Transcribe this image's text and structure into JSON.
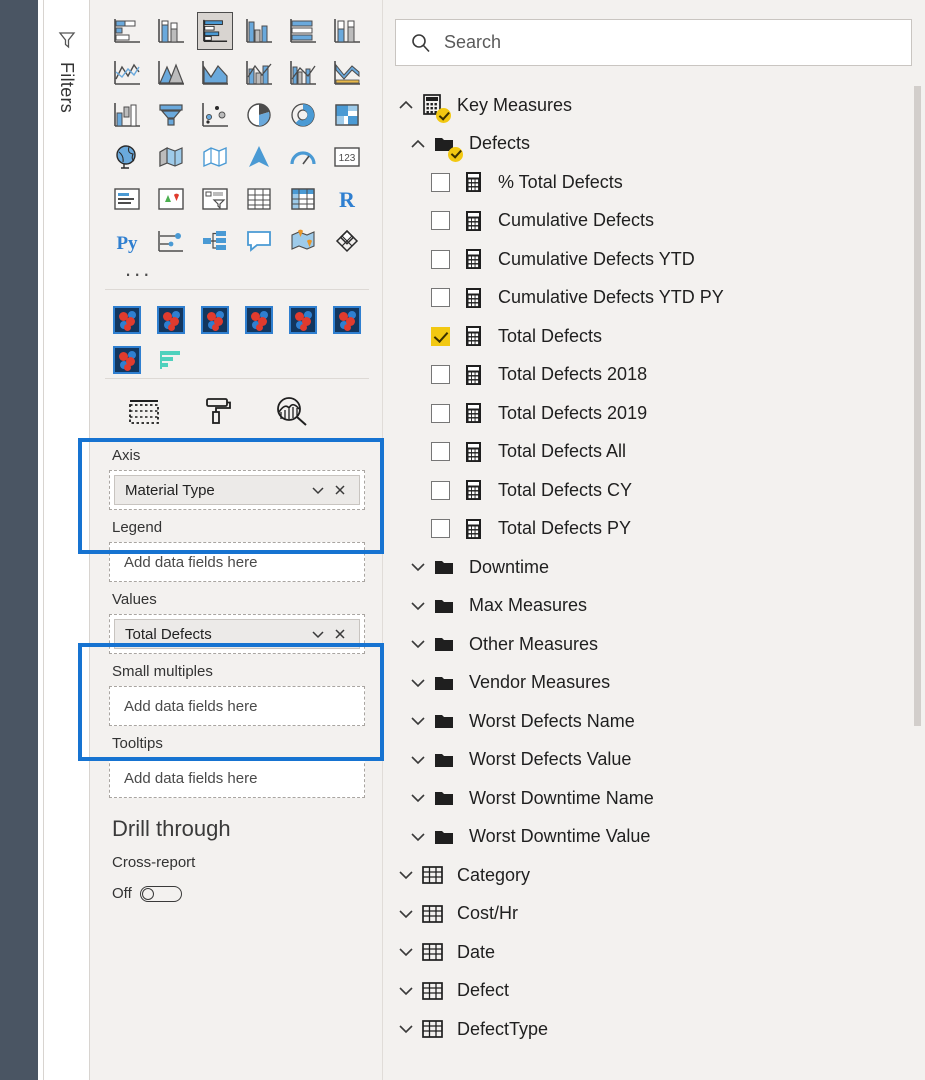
{
  "filters_pane": {
    "label": "Filters",
    "icon": "filter-funnel-icon"
  },
  "visualizations": {
    "gallery": [
      [
        {
          "name": "stacked-bar-chart",
          "selected": false
        },
        {
          "name": "stacked-column-chart",
          "selected": false
        },
        {
          "name": "clustered-bar-chart",
          "selected": true
        },
        {
          "name": "clustered-column-chart",
          "selected": false
        },
        {
          "name": "100-percent-stacked-bar-chart",
          "selected": false
        },
        {
          "name": "100-percent-stacked-column-chart",
          "selected": false
        }
      ],
      [
        {
          "name": "line-chart",
          "selected": false
        },
        {
          "name": "area-chart",
          "selected": false
        },
        {
          "name": "stacked-area-chart",
          "selected": false
        },
        {
          "name": "line-and-stacked-column-chart",
          "selected": false
        },
        {
          "name": "line-and-clustered-column-chart",
          "selected": false
        },
        {
          "name": "ribbon-chart",
          "selected": false
        }
      ],
      [
        {
          "name": "waterfall-chart",
          "selected": false
        },
        {
          "name": "funnel-chart",
          "selected": false
        },
        {
          "name": "scatter-chart",
          "selected": false
        },
        {
          "name": "pie-chart",
          "selected": false
        },
        {
          "name": "donut-chart",
          "selected": false
        },
        {
          "name": "treemap-chart",
          "selected": false
        }
      ],
      [
        {
          "name": "map-visual",
          "selected": false
        },
        {
          "name": "filled-map-visual",
          "selected": false
        },
        {
          "name": "shape-map-visual",
          "selected": false
        },
        {
          "name": "azure-map-visual",
          "selected": false
        },
        {
          "name": "gauge-visual",
          "selected": false
        },
        {
          "name": "card-visual",
          "selected": false
        }
      ],
      [
        {
          "name": "multi-row-card-visual",
          "selected": false
        },
        {
          "name": "kpi-visual",
          "selected": false
        },
        {
          "name": "slicer-visual",
          "selected": false
        },
        {
          "name": "table-visual",
          "selected": false
        },
        {
          "name": "matrix-visual",
          "selected": false
        },
        {
          "name": "r-script-visual",
          "selected": false
        }
      ],
      [
        {
          "name": "python-script-visual",
          "selected": false
        },
        {
          "name": "key-influencers-visual",
          "selected": false
        },
        {
          "name": "decomposition-tree-visual",
          "selected": false
        },
        {
          "name": "qna-visual",
          "selected": false
        },
        {
          "name": "smart-narrative-visual",
          "selected": false
        },
        {
          "name": "paginated-report-visual",
          "selected": false
        }
      ]
    ],
    "more_label": "...",
    "custom_visuals": [
      {
        "name": "custom-visual-1",
        "type": "pinwheel"
      },
      {
        "name": "custom-visual-2",
        "type": "pinwheel"
      },
      {
        "name": "custom-visual-3",
        "type": "pinwheel"
      },
      {
        "name": "custom-visual-4",
        "type": "pinwheel"
      },
      {
        "name": "custom-visual-5",
        "type": "pinwheel"
      },
      {
        "name": "custom-visual-6",
        "type": "pinwheel"
      },
      {
        "name": "custom-visual-7",
        "type": "pinwheel"
      },
      {
        "name": "custom-visual-8",
        "type": "teal-bar"
      }
    ],
    "tabs": [
      {
        "name": "fields-tab",
        "icon": "fields-table-icon",
        "selected": true
      },
      {
        "name": "format-tab",
        "icon": "paint-roller-icon",
        "selected": false
      },
      {
        "name": "analytics-tab",
        "icon": "magnifier-chart-icon",
        "selected": false
      }
    ],
    "wells": [
      {
        "label": "Axis",
        "highlighted": true,
        "chip": {
          "name": "Material Type",
          "dropdown_icon": "chevron-down-icon",
          "remove_icon": "close-x-icon"
        },
        "placeholder": null
      },
      {
        "label": "Legend",
        "highlighted": false,
        "chip": null,
        "placeholder": "Add data fields here"
      },
      {
        "label": "Values",
        "highlighted": true,
        "chip": {
          "name": "Total Defects",
          "dropdown_icon": "chevron-down-icon",
          "remove_icon": "close-x-icon"
        },
        "placeholder": null
      },
      {
        "label": "Small multiples",
        "highlighted": false,
        "chip": null,
        "placeholder": "Add data fields here"
      },
      {
        "label": "Tooltips",
        "highlighted": false,
        "chip": null,
        "placeholder": "Add data fields here"
      }
    ],
    "drill_through": {
      "title": "Drill through",
      "cross_report_label": "Cross-report",
      "toggle_label": "Off",
      "toggle_on": false
    },
    "highlight_color": "#1673d1"
  },
  "fields": {
    "search": {
      "placeholder": "Search",
      "value": "",
      "icon": "search-icon"
    },
    "tree": [
      {
        "level": 0,
        "label": "Key Measures",
        "icon": "measure-table-icon",
        "chevron": "up",
        "badge": true,
        "checkbox": null
      },
      {
        "level": 1,
        "label": "Defects",
        "icon": "folder-icon",
        "chevron": "up",
        "badge": true,
        "checkbox": null
      },
      {
        "level": 2,
        "label": "% Total Defects",
        "icon": "calculator-icon",
        "chevron": null,
        "badge": false,
        "checkbox": false
      },
      {
        "level": 2,
        "label": "Cumulative Defects",
        "icon": "calculator-icon",
        "chevron": null,
        "badge": false,
        "checkbox": false
      },
      {
        "level": 2,
        "label": "Cumulative Defects YTD",
        "icon": "calculator-icon",
        "chevron": null,
        "badge": false,
        "checkbox": false
      },
      {
        "level": 2,
        "label": "Cumulative Defects YTD PY",
        "icon": "calculator-icon",
        "chevron": null,
        "badge": false,
        "checkbox": false
      },
      {
        "level": 2,
        "label": "Total Defects",
        "icon": "calculator-icon",
        "chevron": null,
        "badge": false,
        "checkbox": true
      },
      {
        "level": 2,
        "label": "Total Defects 2018",
        "icon": "calculator-icon",
        "chevron": null,
        "badge": false,
        "checkbox": false
      },
      {
        "level": 2,
        "label": "Total Defects 2019",
        "icon": "calculator-icon",
        "chevron": null,
        "badge": false,
        "checkbox": false
      },
      {
        "level": 2,
        "label": "Total Defects All",
        "icon": "calculator-icon",
        "chevron": null,
        "badge": false,
        "checkbox": false
      },
      {
        "level": 2,
        "label": "Total Defects CY",
        "icon": "calculator-icon",
        "chevron": null,
        "badge": false,
        "checkbox": false
      },
      {
        "level": 2,
        "label": "Total Defects PY",
        "icon": "calculator-icon",
        "chevron": null,
        "badge": false,
        "checkbox": false
      },
      {
        "level": 1,
        "label": "Downtime",
        "icon": "folder-icon",
        "chevron": "down",
        "badge": false,
        "checkbox": null
      },
      {
        "level": 1,
        "label": "Max Measures",
        "icon": "folder-icon",
        "chevron": "down",
        "badge": false,
        "checkbox": null
      },
      {
        "level": 1,
        "label": "Other Measures",
        "icon": "folder-icon",
        "chevron": "down",
        "badge": false,
        "checkbox": null
      },
      {
        "level": 1,
        "label": "Vendor Measures",
        "icon": "folder-icon",
        "chevron": "down",
        "badge": false,
        "checkbox": null
      },
      {
        "level": 1,
        "label": "Worst Defects Name",
        "icon": "folder-icon",
        "chevron": "down",
        "badge": false,
        "checkbox": null
      },
      {
        "level": 1,
        "label": "Worst Defects Value",
        "icon": "folder-icon",
        "chevron": "down",
        "badge": false,
        "checkbox": null
      },
      {
        "level": 1,
        "label": "Worst Downtime Name",
        "icon": "folder-icon",
        "chevron": "down",
        "badge": false,
        "checkbox": null
      },
      {
        "level": 1,
        "label": "Worst Downtime Value",
        "icon": "folder-icon",
        "chevron": "down",
        "badge": false,
        "checkbox": null
      },
      {
        "level": 0,
        "label": "Category",
        "icon": "table-icon",
        "chevron": "down",
        "badge": false,
        "checkbox": null
      },
      {
        "level": 0,
        "label": "Cost/Hr",
        "icon": "table-icon",
        "chevron": "down",
        "badge": false,
        "checkbox": null
      },
      {
        "level": 0,
        "label": "Date",
        "icon": "table-icon",
        "chevron": "down",
        "badge": false,
        "checkbox": null
      },
      {
        "level": 0,
        "label": "Defect",
        "icon": "table-icon",
        "chevron": "down",
        "badge": false,
        "checkbox": null
      },
      {
        "level": 0,
        "label": "DefectType",
        "icon": "table-icon",
        "chevron": "down",
        "badge": false,
        "checkbox": null
      }
    ],
    "scrollbar": {
      "name": "fields-vertical-scrollbar"
    }
  },
  "colors": {
    "accent_blue": "#1673d1",
    "check_yellow": "#f2c811",
    "pane_bg": "#f3f1ef",
    "canvas_edge": "#4a5563"
  }
}
